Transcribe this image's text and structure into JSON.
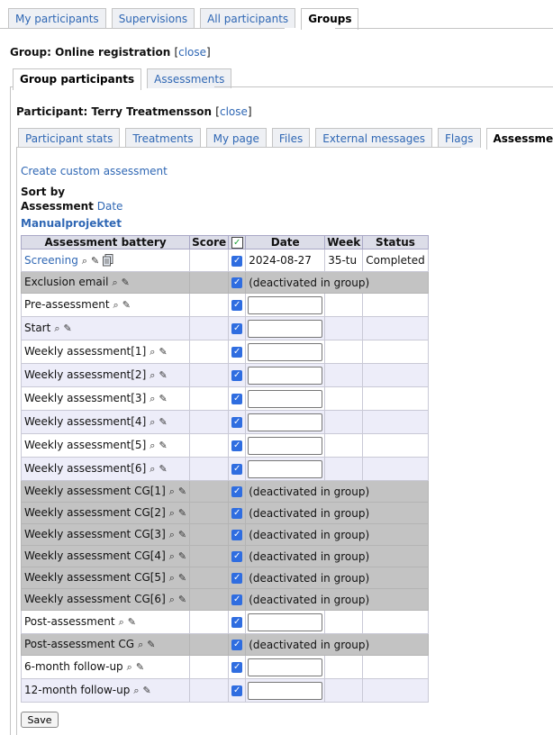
{
  "top_tabs": [
    {
      "label": "My participants",
      "active": false
    },
    {
      "label": "Supervisions",
      "active": false
    },
    {
      "label": "All participants",
      "active": false
    },
    {
      "label": "Groups",
      "active": true
    }
  ],
  "group": {
    "label": "Group: Online registration",
    "close": "close"
  },
  "group_tabs": [
    {
      "label": "Group participants",
      "active": true
    },
    {
      "label": "Assessments",
      "active": false
    }
  ],
  "participant": {
    "label": "Participant: Terry Treatmensson",
    "close": "close"
  },
  "participant_tabs": [
    {
      "label": "Participant stats",
      "active": false
    },
    {
      "label": "Treatments",
      "active": false
    },
    {
      "label": "My page",
      "active": false
    },
    {
      "label": "Files",
      "active": false
    },
    {
      "label": "External messages",
      "active": false
    },
    {
      "label": "Flags",
      "active": false
    },
    {
      "label": "Assessments",
      "active": true
    }
  ],
  "create_link": "Create custom assessment",
  "sort": {
    "label": "Sort by",
    "assessment": "Assessment",
    "date": "Date"
  },
  "project": "Manualprojektet",
  "table": {
    "headers": [
      "Assessment battery",
      "Score",
      "",
      "Date",
      "Week",
      "Status"
    ],
    "rows": [
      {
        "name": "Screening",
        "link": true,
        "state": "done",
        "date": "2024-08-27",
        "week": "35-tu",
        "status": "Completed"
      },
      {
        "name": "Exclusion email",
        "state": "deact",
        "note": "(deactivated in group)"
      },
      {
        "name": "Pre-assessment",
        "state": "input"
      },
      {
        "name": "Start",
        "state": "input"
      },
      {
        "name": "Weekly assessment[1]",
        "state": "input"
      },
      {
        "name": "Weekly assessment[2]",
        "state": "input"
      },
      {
        "name": "Weekly assessment[3]",
        "state": "input"
      },
      {
        "name": "Weekly assessment[4]",
        "state": "input"
      },
      {
        "name": "Weekly assessment[5]",
        "state": "input"
      },
      {
        "name": "Weekly assessment[6]",
        "state": "input"
      },
      {
        "name": "Weekly assessment CG[1]",
        "state": "deact",
        "note": "(deactivated in group)"
      },
      {
        "name": "Weekly assessment CG[2]",
        "state": "deact",
        "note": "(deactivated in group)"
      },
      {
        "name": "Weekly assessment CG[3]",
        "state": "deact",
        "note": "(deactivated in group)"
      },
      {
        "name": "Weekly assessment CG[4]",
        "state": "deact",
        "note": "(deactivated in group)"
      },
      {
        "name": "Weekly assessment CG[5]",
        "state": "deact",
        "note": "(deactivated in group)"
      },
      {
        "name": "Weekly assessment CG[6]",
        "state": "deact",
        "note": "(deactivated in group)"
      },
      {
        "name": "Post-assessment",
        "state": "input"
      },
      {
        "name": "Post-assessment CG",
        "state": "deact",
        "note": "(deactivated in group)"
      },
      {
        "name": "6-month follow-up",
        "state": "input"
      },
      {
        "name": "12-month follow-up",
        "state": "input"
      }
    ]
  },
  "save_label": "Save",
  "icons": {
    "view": "magnifier-icon",
    "edit": "pencil-icon",
    "copy": "copy-icon",
    "check": "checkbox-icon"
  }
}
